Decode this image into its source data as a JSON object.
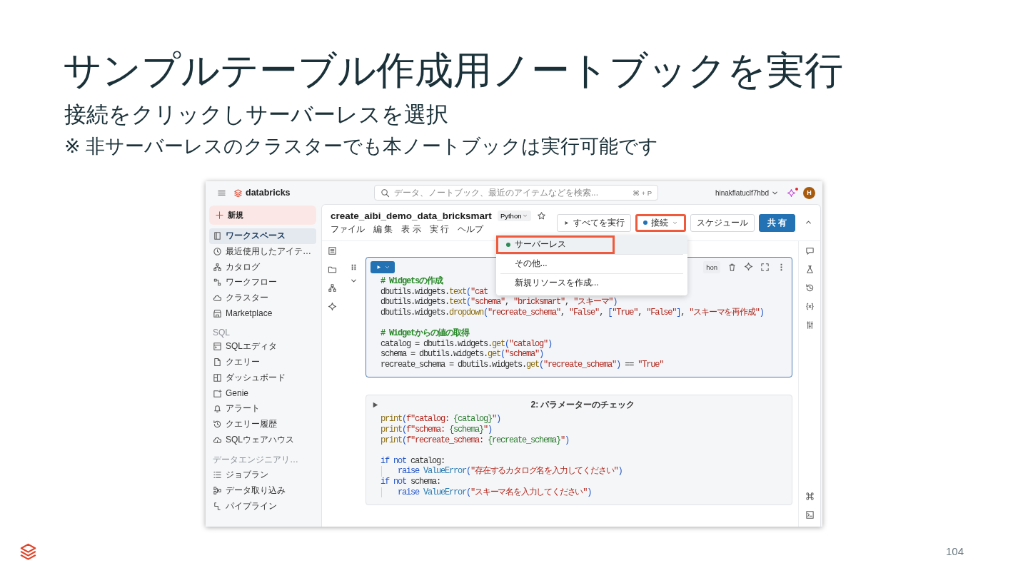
{
  "slide": {
    "title": "サンプルテーブル作成用ノートブックを実行",
    "subtitle": "接続をクリックしサーバーレスを選択",
    "note": "※ 非サーバーレスのクラスターでも本ノートブックは実行可能です",
    "page_number": "104"
  },
  "app": {
    "topbar": {
      "logo": "databricks",
      "search": {
        "placeholder": "データ、ノートブック、最近のアイテムなどを検索...",
        "shortcut": "⌘ + P"
      },
      "user": "hinakflatuclf7hbd",
      "notification_dot": true,
      "avatar": "H"
    },
    "sidebar": {
      "new_button": "新規",
      "groups": [
        {
          "items": [
            {
              "label": "ワークスペース",
              "selected": true
            },
            {
              "label": "最近使用したアイテ…",
              "selected": false
            },
            {
              "label": "カタログ",
              "selected": false
            },
            {
              "label": "ワークフロー",
              "selected": false
            },
            {
              "label": "クラスター",
              "selected": false
            },
            {
              "label": "Marketplace",
              "selected": false
            }
          ]
        },
        {
          "heading": "SQL",
          "items": [
            {
              "label": "SQLエディタ",
              "selected": false
            },
            {
              "label": "クエリー",
              "selected": false
            },
            {
              "label": "ダッシュボード",
              "selected": false
            },
            {
              "label": "Genie",
              "selected": false
            },
            {
              "label": "アラート",
              "selected": false
            },
            {
              "label": "クエリー履歴",
              "selected": false
            },
            {
              "label": "SQLウェアハウス",
              "selected": false
            }
          ]
        },
        {
          "heading": "データエンジニアリ…",
          "items": [
            {
              "label": "ジョブラン",
              "selected": false
            },
            {
              "label": "データ取り込み",
              "selected": false
            },
            {
              "label": "パイプライン",
              "selected": false
            }
          ]
        }
      ]
    },
    "notebook": {
      "title": "create_aibi_demo_data_bricksmart",
      "language": "Python",
      "favorite": false,
      "menus": [
        "ファイル",
        "編 集",
        "表 示",
        "実 行",
        "ヘルプ"
      ],
      "toolbar": [
        {
          "kind": "run_all",
          "label": "すべてを実行",
          "annotated": false
        },
        {
          "kind": "connect",
          "label": "接続",
          "annotated": true
        },
        {
          "kind": "schedule",
          "label": "スケジュール",
          "annotated": false
        },
        {
          "kind": "share",
          "label": "共 有",
          "annotated": false
        }
      ],
      "compute_menu": [
        {
          "label": "サーバーレス",
          "color": "#2e8b57",
          "selected": true,
          "annotated": true
        },
        {
          "label": "その他...",
          "selected": false,
          "annotated": false
        },
        {
          "label": "新規リソースを作成...",
          "selected": false,
          "annotated": false
        }
      ],
      "cells": [
        {
          "selected": true,
          "language_badge": "hon",
          "lines": [
            {
              "kind": "code",
              "tokens": [
                {
                  "kind": "comment",
                  "text": "# Widgetsの作成"
                }
              ]
            },
            {
              "kind": "code",
              "tokens": [
                {
                  "kind": "plain",
                  "text": "dbutils.widgets."
                },
                {
                  "kind": "fn",
                  "text": "text"
                },
                {
                  "kind": "paren",
                  "text": "("
                },
                {
                  "kind": "str",
                  "text": "\"cat"
                }
              ]
            },
            {
              "kind": "code",
              "tokens": [
                {
                  "kind": "plain",
                  "text": "dbutils.widgets."
                },
                {
                  "kind": "fn",
                  "text": "text"
                },
                {
                  "kind": "paren",
                  "text": "("
                },
                {
                  "kind": "str",
                  "text": "\"schema\""
                },
                {
                  "kind": "plain",
                  "text": ", "
                },
                {
                  "kind": "str",
                  "text": "\"bricksmart\""
                },
                {
                  "kind": "plain",
                  "text": ", "
                },
                {
                  "kind": "str",
                  "text": "\"スキーマ\""
                },
                {
                  "kind": "paren",
                  "text": ")"
                }
              ]
            },
            {
              "kind": "code",
              "tokens": [
                {
                  "kind": "plain",
                  "text": "dbutils.widgets."
                },
                {
                  "kind": "fn",
                  "text": "dropdown"
                },
                {
                  "kind": "paren",
                  "text": "("
                },
                {
                  "kind": "str",
                  "text": "\"recreate_schema\""
                },
                {
                  "kind": "plain",
                  "text": ", "
                },
                {
                  "kind": "str",
                  "text": "\"False\""
                },
                {
                  "kind": "plain",
                  "text": ", "
                },
                {
                  "kind": "paren",
                  "text": "["
                },
                {
                  "kind": "str",
                  "text": "\"True\""
                },
                {
                  "kind": "plain",
                  "text": ", "
                },
                {
                  "kind": "str",
                  "text": "\"False\""
                },
                {
                  "kind": "paren",
                  "text": "]"
                },
                {
                  "kind": "plain",
                  "text": ", "
                },
                {
                  "kind": "str",
                  "text": "\"スキーマを再作成\""
                },
                {
                  "kind": "paren",
                  "text": ")"
                }
              ]
            },
            {
              "kind": "blank"
            },
            {
              "kind": "code",
              "tokens": [
                {
                  "kind": "comment",
                  "text": "# Widgetからの値の取得"
                }
              ]
            },
            {
              "kind": "code",
              "tokens": [
                {
                  "kind": "plain",
                  "text": "catalog = dbutils.widgets."
                },
                {
                  "kind": "fn",
                  "text": "get"
                },
                {
                  "kind": "paren",
                  "text": "("
                },
                {
                  "kind": "str",
                  "text": "\"catalog\""
                },
                {
                  "kind": "paren",
                  "text": ")"
                }
              ]
            },
            {
              "kind": "code",
              "tokens": [
                {
                  "kind": "plain",
                  "text": "schema = dbutils.widgets."
                },
                {
                  "kind": "fn",
                  "text": "get"
                },
                {
                  "kind": "paren",
                  "text": "("
                },
                {
                  "kind": "str",
                  "text": "\"schema\""
                },
                {
                  "kind": "paren",
                  "text": ")"
                }
              ]
            },
            {
              "kind": "code",
              "tokens": [
                {
                  "kind": "plain",
                  "text": "recreate_schema = dbutils.widgets."
                },
                {
                  "kind": "fn",
                  "text": "get"
                },
                {
                  "kind": "paren",
                  "text": "("
                },
                {
                  "kind": "str",
                  "text": "\"recreate_schema\""
                },
                {
                  "kind": "paren",
                  "text": ")"
                },
                {
                  "kind": "plain",
                  "text": " == "
                },
                {
                  "kind": "str",
                  "text": "\"True\""
                }
              ]
            }
          ]
        },
        {
          "selected": false,
          "title": "2: パラメーターのチェック",
          "lines": [
            {
              "kind": "code",
              "tokens": [
                {
                  "kind": "fn",
                  "text": "print"
                },
                {
                  "kind": "paren",
                  "text": "("
                },
                {
                  "kind": "str",
                  "text": "f\"catalog: "
                },
                {
                  "kind": "interp",
                  "text": "{catalog}"
                },
                {
                  "kind": "str",
                  "text": "\""
                },
                {
                  "kind": "paren",
                  "text": ")"
                }
              ]
            },
            {
              "kind": "code",
              "tokens": [
                {
                  "kind": "fn",
                  "text": "print"
                },
                {
                  "kind": "paren",
                  "text": "("
                },
                {
                  "kind": "str",
                  "text": "f\"schema: "
                },
                {
                  "kind": "interp",
                  "text": "{schema}"
                },
                {
                  "kind": "str",
                  "text": "\""
                },
                {
                  "kind": "paren",
                  "text": ")"
                }
              ]
            },
            {
              "kind": "code",
              "tokens": [
                {
                  "kind": "fn",
                  "text": "print"
                },
                {
                  "kind": "paren",
                  "text": "("
                },
                {
                  "kind": "str",
                  "text": "f\"recreate_schema: "
                },
                {
                  "kind": "interp",
                  "text": "{recreate_schema}"
                },
                {
                  "kind": "str",
                  "text": "\""
                },
                {
                  "kind": "paren",
                  "text": ")"
                }
              ]
            },
            {
              "kind": "blank"
            },
            {
              "kind": "code",
              "tokens": [
                {
                  "kind": "kw",
                  "text": "if not"
                },
                {
                  "kind": "plain",
                  "text": " catalog:"
                }
              ]
            },
            {
              "kind": "indented",
              "tokens": [
                {
                  "kind": "kw",
                  "text": "raise"
                },
                {
                  "kind": "builtin",
                  "text": " ValueError"
                },
                {
                  "kind": "paren",
                  "text": "("
                },
                {
                  "kind": "str",
                  "text": "\"存在するカタログ名を入力してください\""
                },
                {
                  "kind": "paren",
                  "text": ")"
                }
              ]
            },
            {
              "kind": "code",
              "tokens": [
                {
                  "kind": "kw",
                  "text": "if not"
                },
                {
                  "kind": "plain",
                  "text": " schema:"
                }
              ]
            },
            {
              "kind": "indented",
              "tokens": [
                {
                  "kind": "kw",
                  "text": "raise"
                },
                {
                  "kind": "builtin",
                  "text": " ValueError"
                },
                {
                  "kind": "paren",
                  "text": "("
                },
                {
                  "kind": "str",
                  "text": "\"スキーマ名を入力してください\""
                },
                {
                  "kind": "paren",
                  "text": ")"
                }
              ]
            }
          ]
        }
      ]
    }
  }
}
